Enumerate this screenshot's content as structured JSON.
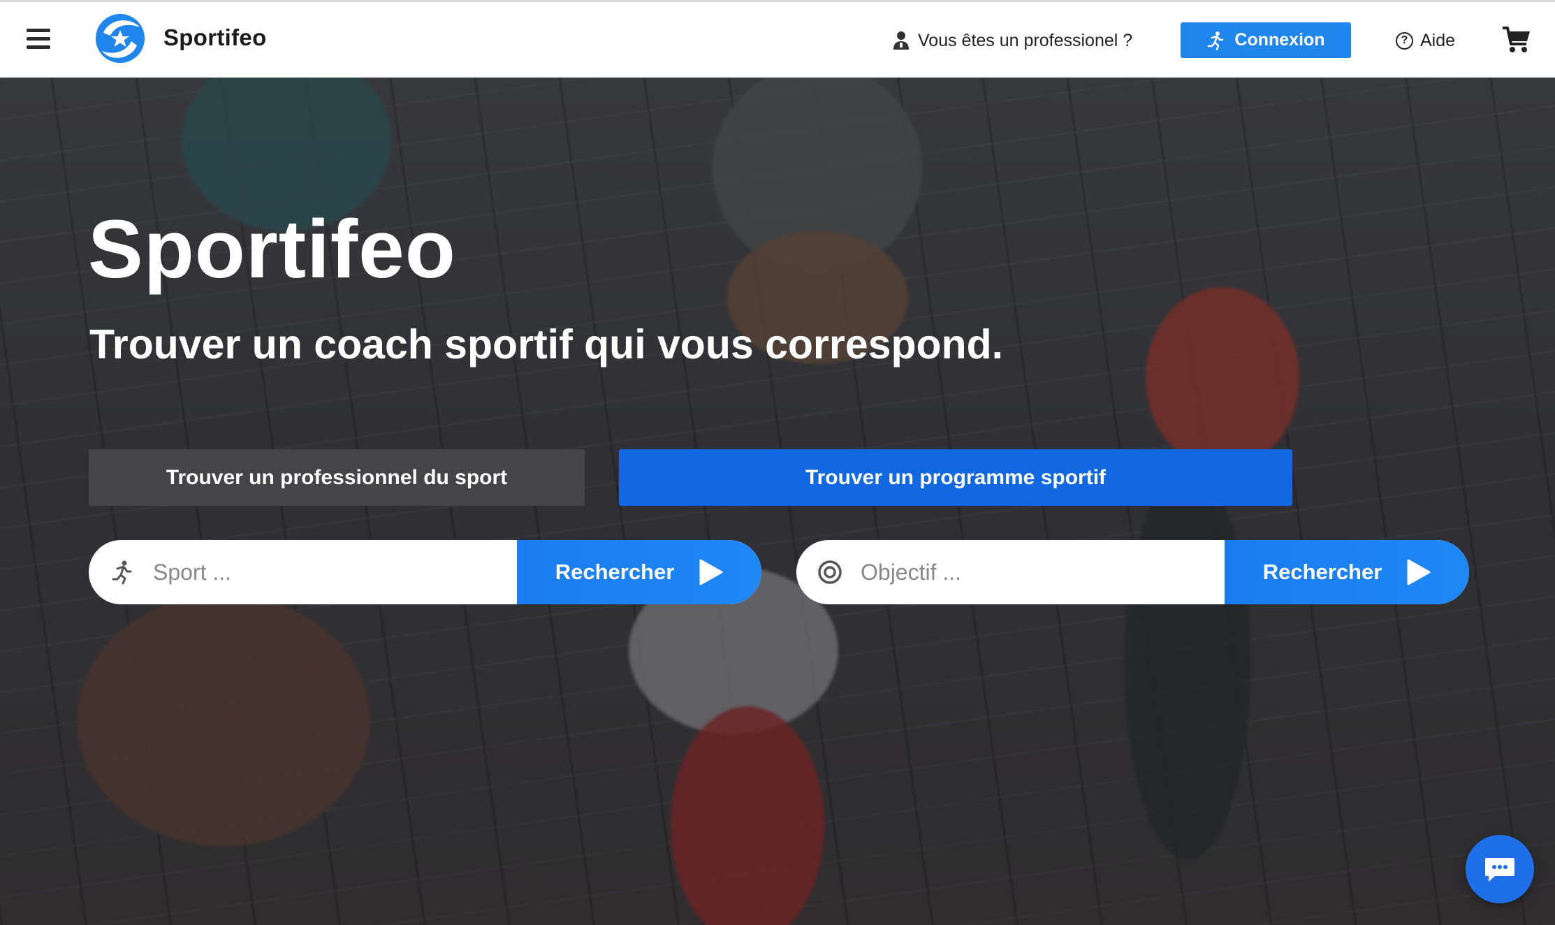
{
  "header": {
    "brand": "Sportifeo",
    "pro_link": "Vous êtes un professionel ?",
    "login_label": "Connexion",
    "help_label": "Aide"
  },
  "hero": {
    "title": "Sportifeo",
    "subtitle": "Trouver un coach sportif qui vous correspond.",
    "tab_pro": "Trouver un professionnel du sport",
    "tab_program": "Trouver un programme sportif",
    "sport_search": {
      "placeholder": "Sport ...",
      "button": "Rechercher"
    },
    "goal_search": {
      "placeholder": "Objectif ...",
      "button": "Rechercher"
    }
  },
  "icons": {
    "menu": "hamburger-menu-icon",
    "logo": "sportifeo-logo-icon",
    "user": "user-icon",
    "runner": "running-person-icon",
    "help": "question-circle-icon",
    "cart": "shopping-cart-icon",
    "target": "target-icon",
    "play": "play-triangle-icon",
    "chat": "chat-bubble-icon"
  },
  "colors": {
    "primary": "#1f86ee",
    "tab_active": "#1168e0",
    "tab_inactive": "#454547",
    "chat": "#1f6fe8"
  }
}
